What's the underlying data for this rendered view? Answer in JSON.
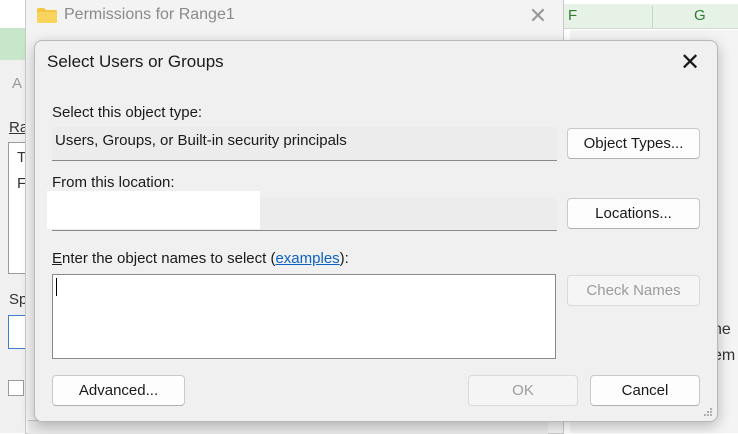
{
  "spreadsheet": {
    "columns": [
      "F",
      "G"
    ],
    "right_text_lines": [
      "he",
      "em"
    ]
  },
  "left_remnants": [
    "A",
    "Ra",
    "T",
    "F",
    "Sp"
  ],
  "perm_window": {
    "title": "Permissions for Range1"
  },
  "dialog": {
    "title": "Select Users or Groups",
    "object_type_label": "Select this object type:",
    "object_type_value": "Users, Groups, or Built-in security principals",
    "object_types_button": "Object Types...",
    "location_label": "From this location:",
    "locations_button": "Locations...",
    "names_label_prefix_u": "E",
    "names_label_prefix": "nter the object names to select (",
    "names_label_link": "examples",
    "names_label_suffix": "):",
    "names_value": "",
    "check_names_button": "Check Names",
    "advanced_button": "Advanced...",
    "ok_button": "OK",
    "cancel_button": "Cancel"
  },
  "colors": {
    "sheet_header": "#e6f2e6",
    "link": "#0b62c4",
    "dialog_bg": "#f0f0f0"
  }
}
